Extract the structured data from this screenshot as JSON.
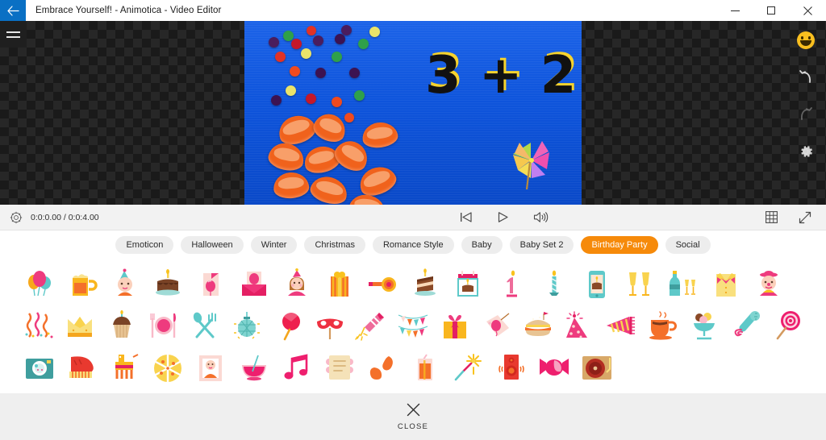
{
  "window": {
    "title": "Embrace Yourself! - Animotica - Video Editor",
    "back_icon": "back-arrow-icon",
    "minimize_label": "–",
    "maximize_label": "❐",
    "close_label": "✕"
  },
  "stage": {
    "menu_icon": "hamburger-menu-icon",
    "tools": [
      {
        "name": "sticker-emoji-tool",
        "icon": "smiley-icon",
        "state": "active"
      },
      {
        "name": "undo-tool",
        "icon": "undo-arrow-icon",
        "state": "enabled"
      },
      {
        "name": "redo-tool",
        "icon": "redo-arrow-icon",
        "state": "disabled"
      },
      {
        "name": "settings-tool",
        "icon": "gear-icon",
        "state": "enabled"
      }
    ],
    "preview": {
      "overlay_text": "3 + 2",
      "sticker": "pinwheel-sticker",
      "description": "Blue canvas with candies and mandarin segments"
    }
  },
  "transport": {
    "settings_icon": "capture-settings-icon",
    "timecode": "0:0:0.00 / 0:0:4.00",
    "current_time": "0:0:0.00",
    "total_time": "0:0:4.00",
    "controls": [
      {
        "name": "skip-to-start-button",
        "icon": "skip-previous-icon"
      },
      {
        "name": "play-button",
        "icon": "play-icon"
      },
      {
        "name": "volume-button",
        "icon": "speaker-icon"
      }
    ],
    "right_controls": [
      {
        "name": "grid-view-button",
        "icon": "grid-icon"
      },
      {
        "name": "fullscreen-button",
        "icon": "expand-diagonal-icon"
      }
    ]
  },
  "tabs": {
    "active_index": 7,
    "active_color": "#f68a0a",
    "items": [
      {
        "label": "Emoticon"
      },
      {
        "label": "Halloween"
      },
      {
        "label": "Winter"
      },
      {
        "label": "Christmas"
      },
      {
        "label": "Romance Style"
      },
      {
        "label": "Baby"
      },
      {
        "label": "Baby Set 2"
      },
      {
        "label": "Birthday Party"
      },
      {
        "label": "Social"
      }
    ]
  },
  "stickers": {
    "category": "Birthday Party",
    "rows": [
      [
        "balloons",
        "beer-mug",
        "party-boy",
        "birthday-cake",
        "greeting-card",
        "envelope-balloon",
        "party-girl",
        "gift-box-striped",
        "party-blower",
        "cake-slice",
        "calendar-cake",
        "candle-number-one",
        "candles-two",
        "phone-cake",
        "champagne-glasses",
        "champagne-bottle",
        "bowtie-shirt",
        "clown"
      ],
      [
        "streamers",
        "crown",
        "cupcake",
        "plate-cutlery",
        "spoon-fork",
        "disco-ball",
        "lollipop-red",
        "eye-mask",
        "firework-rocket",
        "bunting-flags",
        "gift-box-pink",
        "balloon-tag",
        "burger",
        "party-hat",
        "party-horn",
        "coffee-cup",
        "ice-cream-sundae",
        "microphone",
        "lollipop-spiral"
      ],
      [
        "instant-camera",
        "grand-piano",
        "pinata",
        "pizza",
        "photo-frame",
        "punch-bowl",
        "music-note",
        "invitation-letter",
        "snacks",
        "juice-glass",
        "sparkler",
        "speaker",
        "wrapped-candy",
        "turntable"
      ]
    ]
  },
  "footer": {
    "close_icon": "close-x-icon",
    "close_label": "CLOSE"
  }
}
